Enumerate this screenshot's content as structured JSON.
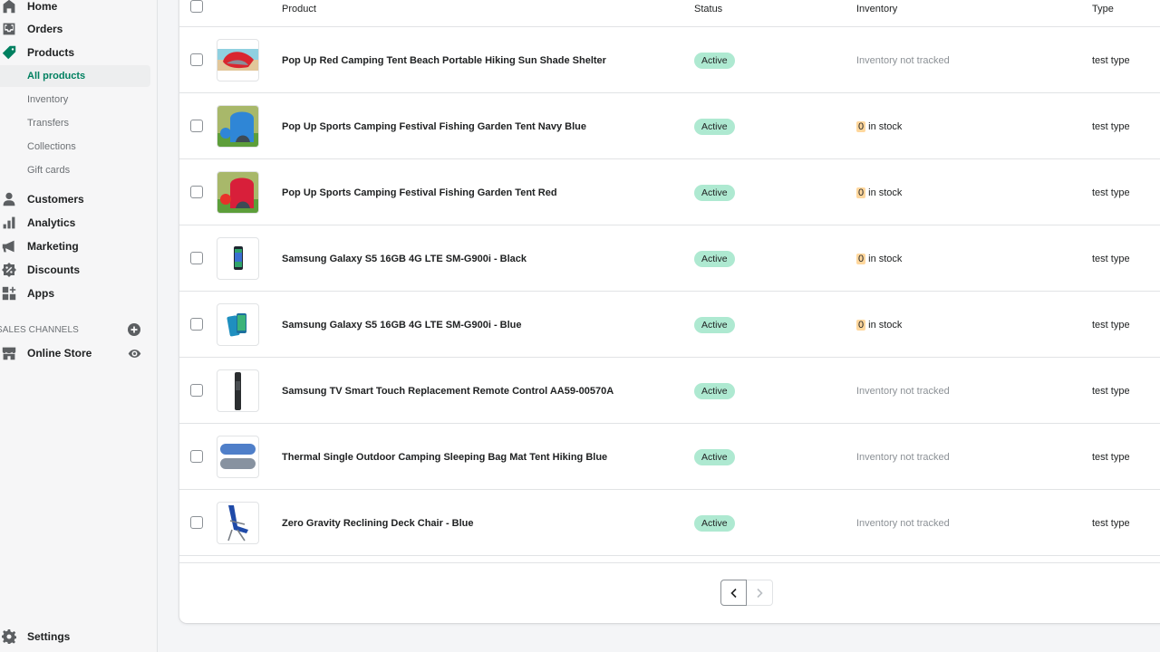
{
  "sidebar": {
    "nav": [
      {
        "label": "Home",
        "icon": "home-icon"
      },
      {
        "label": "Orders",
        "icon": "orders-icon"
      },
      {
        "label": "Products",
        "icon": "tag-icon",
        "active": true
      },
      {
        "label": "Customers",
        "icon": "person-icon"
      },
      {
        "label": "Analytics",
        "icon": "bar-chart-icon"
      },
      {
        "label": "Marketing",
        "icon": "megaphone-icon"
      },
      {
        "label": "Discounts",
        "icon": "discount-icon"
      },
      {
        "label": "Apps",
        "icon": "apps-icon"
      }
    ],
    "products_sub": [
      {
        "label": "All products",
        "selected": true
      },
      {
        "label": "Inventory"
      },
      {
        "label": "Transfers"
      },
      {
        "label": "Collections"
      },
      {
        "label": "Gift cards"
      }
    ],
    "sales_channels_title": "SALES CHANNELS",
    "online_store": {
      "label": "Online Store",
      "icon": "store-icon"
    },
    "settings": {
      "label": "Settings",
      "icon": "gear-icon"
    }
  },
  "table": {
    "headers": {
      "product": "Product",
      "status": "Status",
      "inventory": "Inventory",
      "type": "Type"
    },
    "rows": [
      {
        "name": "Pop Up Red Camping Tent Beach Portable Hiking Sun Shade Shelter",
        "status": "Active",
        "inventory_text": "Inventory not tracked",
        "tracked": false,
        "type": "test type",
        "thumb": "red-beach-tent"
      },
      {
        "name": "Pop Up Sports Camping Festival Fishing Garden Tent Navy Blue",
        "status": "Active",
        "stock": "0",
        "stock_suffix": "in stock",
        "tracked": true,
        "type": "test type",
        "thumb": "blue-garden-tent"
      },
      {
        "name": "Pop Up Sports Camping Festival Fishing Garden Tent Red",
        "status": "Active",
        "stock": "0",
        "stock_suffix": "in stock",
        "tracked": true,
        "type": "test type",
        "thumb": "red-garden-tent"
      },
      {
        "name": "Samsung Galaxy S5 16GB 4G LTE SM-G900i - Black",
        "status": "Active",
        "stock": "0",
        "stock_suffix": "in stock",
        "tracked": true,
        "type": "test type",
        "thumb": "phone-black"
      },
      {
        "name": "Samsung Galaxy S5 16GB 4G LTE SM-G900i - Blue",
        "status": "Active",
        "stock": "0",
        "stock_suffix": "in stock",
        "tracked": true,
        "type": "test type",
        "thumb": "phone-blue"
      },
      {
        "name": "Samsung TV Smart Touch Replacement Remote Control AA59-00570A",
        "status": "Active",
        "inventory_text": "Inventory not tracked",
        "tracked": false,
        "type": "test type",
        "thumb": "remote"
      },
      {
        "name": "Thermal Single Outdoor Camping Sleeping Bag Mat Tent Hiking Blue",
        "status": "Active",
        "inventory_text": "Inventory not tracked",
        "tracked": false,
        "type": "test type",
        "thumb": "sleeping-bag"
      },
      {
        "name": "Zero Gravity Reclining Deck Chair - Blue",
        "status": "Active",
        "inventory_text": "Inventory not tracked",
        "tracked": false,
        "type": "test type",
        "thumb": "deck-chair"
      }
    ]
  },
  "pagination": {
    "prev_enabled": true,
    "next_enabled": false
  },
  "colors": {
    "accent": "#008060",
    "badge_active": "#aee9d1",
    "stock_highlight": "#ffd79d"
  }
}
